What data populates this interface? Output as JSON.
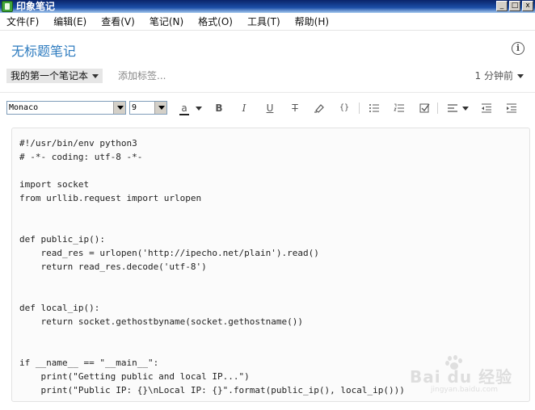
{
  "window": {
    "title": "印象笔记",
    "buttons": [
      "_",
      "□",
      "x"
    ]
  },
  "menu": [
    "文件(F)",
    "编辑(E)",
    "查看(V)",
    "笔记(N)",
    "格式(O)",
    "工具(T)",
    "帮助(H)"
  ],
  "note": {
    "title": "无标题笔记",
    "notebook": "我的第一个笔记本",
    "tag_placeholder": "添加标签...",
    "updated": "1 分钟前"
  },
  "format_toolbar": {
    "font": "Monaco",
    "size": "9",
    "text_color_glyph": "a",
    "bold": "B",
    "italic": "I",
    "underline": "U",
    "strike": "T",
    "code": "{}"
  },
  "code_lines": [
    "#!/usr/bin/env python3",
    "# -*- coding: utf-8 -*-",
    "",
    "import socket",
    "from urllib.request import urlopen",
    "",
    "",
    "def public_ip():",
    "    read_res = urlopen('http://ipecho.net/plain').read()",
    "    return read_res.decode('utf-8')",
    "",
    "",
    "def local_ip():",
    "    return socket.gethostbyname(socket.gethostname())",
    "",
    "",
    "if __name__ == \"__main__\":",
    "    print(\"Getting public and local IP...\")",
    "    print(\"Public IP: {}\\nLocal IP: {}\".format(public_ip(), local_ip()))"
  ],
  "watermark": {
    "text": "Bai du 经验",
    "url": "jingyan.baidu.com"
  },
  "icons": {
    "info": "info-icon",
    "highlighter": "highlighter-icon",
    "bulleted_list": "bulleted-list-icon",
    "numbered_list": "numbered-list-icon",
    "checkbox": "checkbox-icon",
    "align": "align-icon",
    "outdent": "outdent-icon",
    "indent": "indent-icon"
  }
}
